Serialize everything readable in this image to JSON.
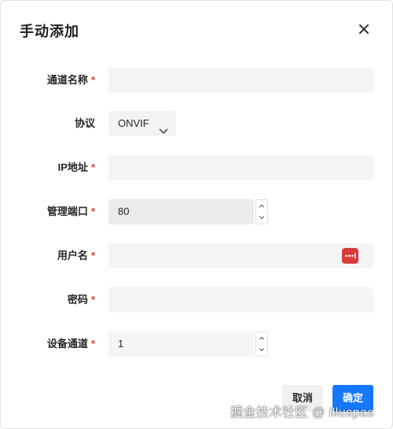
{
  "dialog": {
    "title": "手动添加"
  },
  "form": {
    "channel_name": {
      "label": "通道名称",
      "required_mark": "*",
      "value": ""
    },
    "protocol": {
      "label": "协议",
      "value": "ONVIF"
    },
    "ip_address": {
      "label": "IP地址",
      "required_mark": "*",
      "value": ""
    },
    "manage_port": {
      "label": "管理端口",
      "required_mark": "*",
      "value": "80"
    },
    "username": {
      "label": "用户名",
      "required_mark": "*",
      "value": ""
    },
    "password": {
      "label": "密码",
      "required_mark": "*",
      "value": ""
    },
    "device_channel": {
      "label": "设备通道",
      "required_mark": "*",
      "value": "1"
    }
  },
  "footer": {
    "cancel_label": "取消",
    "ok_label": "确定"
  },
  "watermark": "掘金技术社区 @ illuspas",
  "colors": {
    "primary": "#1677ff",
    "required": "#e53935",
    "password_manager_icon": "#d93a3a",
    "input_bg": "#f5f5f5"
  },
  "icons": [
    "close-icon",
    "chevron-down-icon",
    "password-manager-icon",
    "chevron-up-icon"
  ]
}
